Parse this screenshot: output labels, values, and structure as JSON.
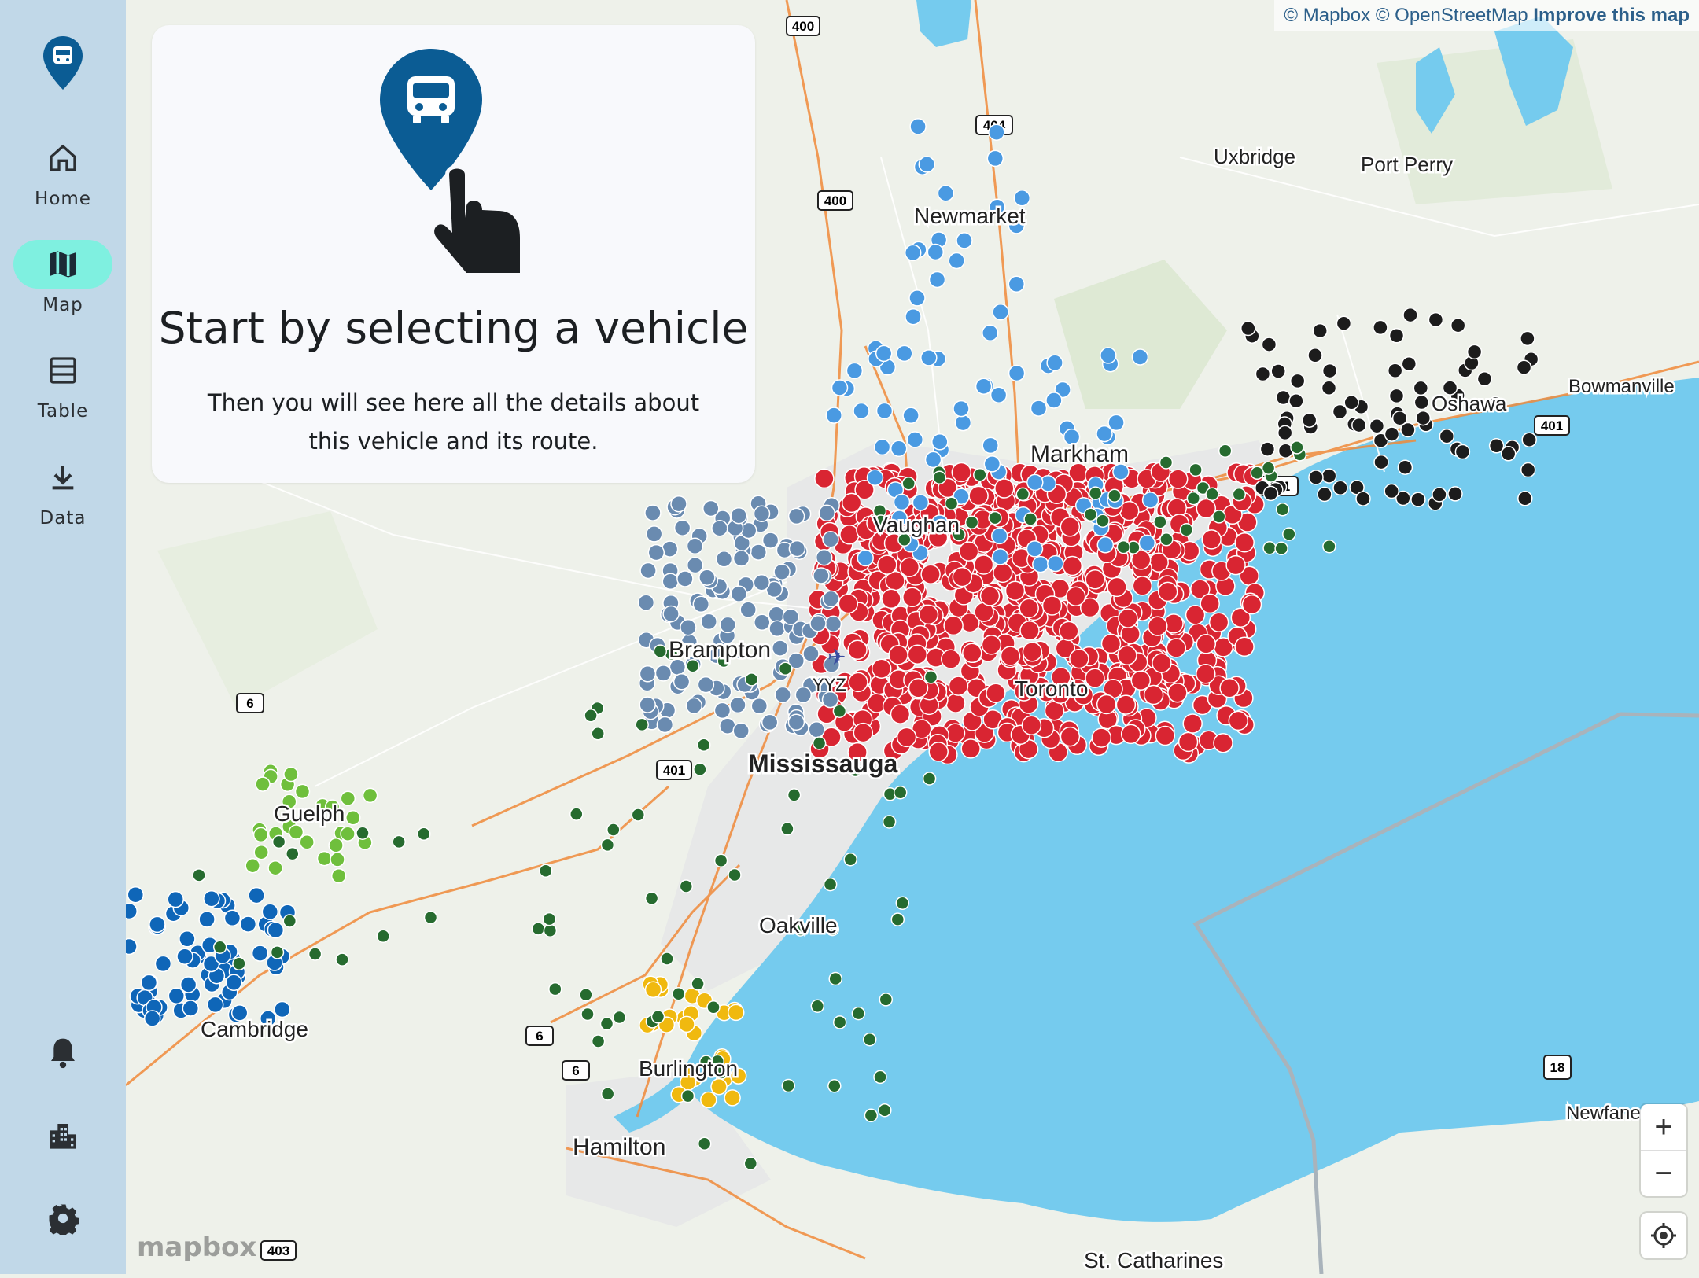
{
  "sidebar": {
    "items": [
      {
        "label": "Home",
        "icon": "home-icon"
      },
      {
        "label": "Map",
        "icon": "map-icon",
        "active": true
      },
      {
        "label": "Table",
        "icon": "table-icon"
      },
      {
        "label": "Data",
        "icon": "download-icon"
      }
    ],
    "bottom_icons": [
      "bell-icon",
      "building-icon",
      "gear-icon"
    ]
  },
  "card": {
    "title": "Start by selecting a vehicle",
    "subtitle": "Then you will see here all the details about this vehicle and its route."
  },
  "attribution": {
    "mapbox": "© Mapbox",
    "osm": "© OpenStreetMap",
    "improve": "Improve this map"
  },
  "map_labels": {
    "uxbridge": "Uxbridge",
    "port_perry": "Port Perry",
    "newmarket": "Newmarket",
    "markham": "Markham",
    "vaughan": "Vaughan",
    "brampton": "Brampton",
    "yyz": "YYZ",
    "mississauga": "Mississauga",
    "guelph": "Guelph",
    "oakville": "Oakville",
    "cambridge": "Cambridge",
    "burlington": "Burlington",
    "hamilton": "Hamilton",
    "bowmanville": "Bowmanville",
    "oshawa": "Oshawa",
    "newfane": "Newfane",
    "st_catharines": "St. Catharines",
    "toronto": "Toronto"
  },
  "highway_shields": [
    "400",
    "404",
    "400",
    "401",
    "401",
    "6",
    "6",
    "6",
    "18",
    "401",
    "403",
    "401"
  ],
  "colors": {
    "accent": "#0b5c94",
    "active_nav": "#7ff0e0",
    "rail": "#c1d8e8",
    "water": "#75cbee",
    "land": "#eef1ea",
    "route_red": "#d92532",
    "route_lightblue": "#4a9ae2",
    "route_slate": "#6a8bb0",
    "route_darkgreen": "#266b2f",
    "route_lightgreen": "#6fbf3c",
    "route_black": "#1c1c1c",
    "route_blue": "#0f66b8",
    "route_yellow": "#f0b90f"
  },
  "controls": {
    "zoom_in": "+",
    "zoom_out": "−"
  },
  "logo": "mapbox"
}
